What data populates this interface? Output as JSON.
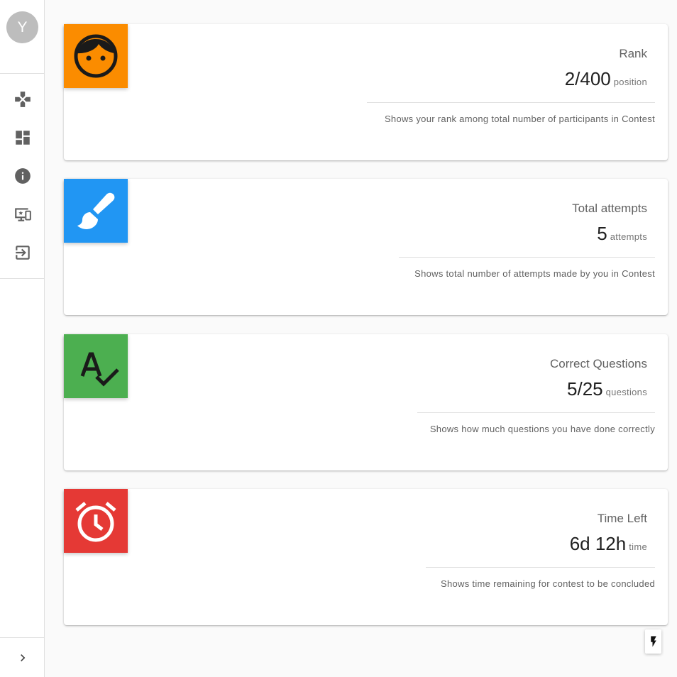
{
  "sidebar": {
    "avatar_letter": "Y",
    "nav": [
      {
        "icon": "gamepad-icon"
      },
      {
        "icon": "dashboard-icon"
      },
      {
        "icon": "info-icon"
      },
      {
        "icon": "devices-star-icon"
      },
      {
        "icon": "exit-to-app-icon"
      }
    ],
    "collapse_icon": "chevron-right-icon"
  },
  "cards": [
    {
      "icon": "face-icon",
      "color": "#fb8c00",
      "title": "Rank",
      "value": "2/400",
      "unit": "position",
      "description": "Shows your rank among total number of participants in Contest"
    },
    {
      "icon": "brush-icon",
      "color": "#2196f3",
      "title": "Total attempts",
      "value": "5",
      "unit": "attempts",
      "description": "Shows total number of attempts made by you in Contest"
    },
    {
      "icon": "spellcheck-icon",
      "color": "#4caf50",
      "title": "Correct Questions",
      "value": "5/25",
      "unit": "questions",
      "description": "Shows how much questions you have done correctly"
    },
    {
      "icon": "alarm-icon",
      "color": "#e53935",
      "title": "Time Left",
      "value": "6d 12h",
      "unit": "time",
      "description": "Shows time remaining for contest to be concluded"
    }
  ],
  "fab_icon": "flash-icon"
}
